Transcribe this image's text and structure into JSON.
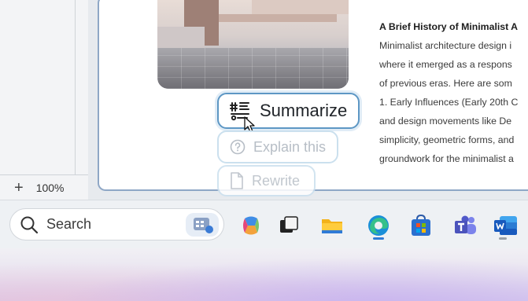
{
  "sidebar": {
    "zoom_add": "+",
    "zoom_level": "100%"
  },
  "article": {
    "title": "A Brief History of Minimalist A",
    "lines": [
      "Minimalist architecture design i",
      "where it emerged as a respons",
      "of previous eras. Here are som",
      "1. Early Influences (Early 20th C",
      "and design movements like De",
      "simplicity, geometric forms, and",
      "groundwork for the minimalist a"
    ]
  },
  "ai_actions": {
    "summarize": "Summarize",
    "explain": "Explain this",
    "rewrite": "Rewrite"
  },
  "taskbar": {
    "search_label": "Search",
    "icons": [
      "copilot-icon",
      "task-view-icon",
      "file-explorer-icon",
      "edge-icon",
      "microsoft-store-icon",
      "teams-icon",
      "word-icon"
    ]
  },
  "colors": {
    "accent_border": "#5d97c4",
    "edge_active": "#2f7bd6"
  }
}
